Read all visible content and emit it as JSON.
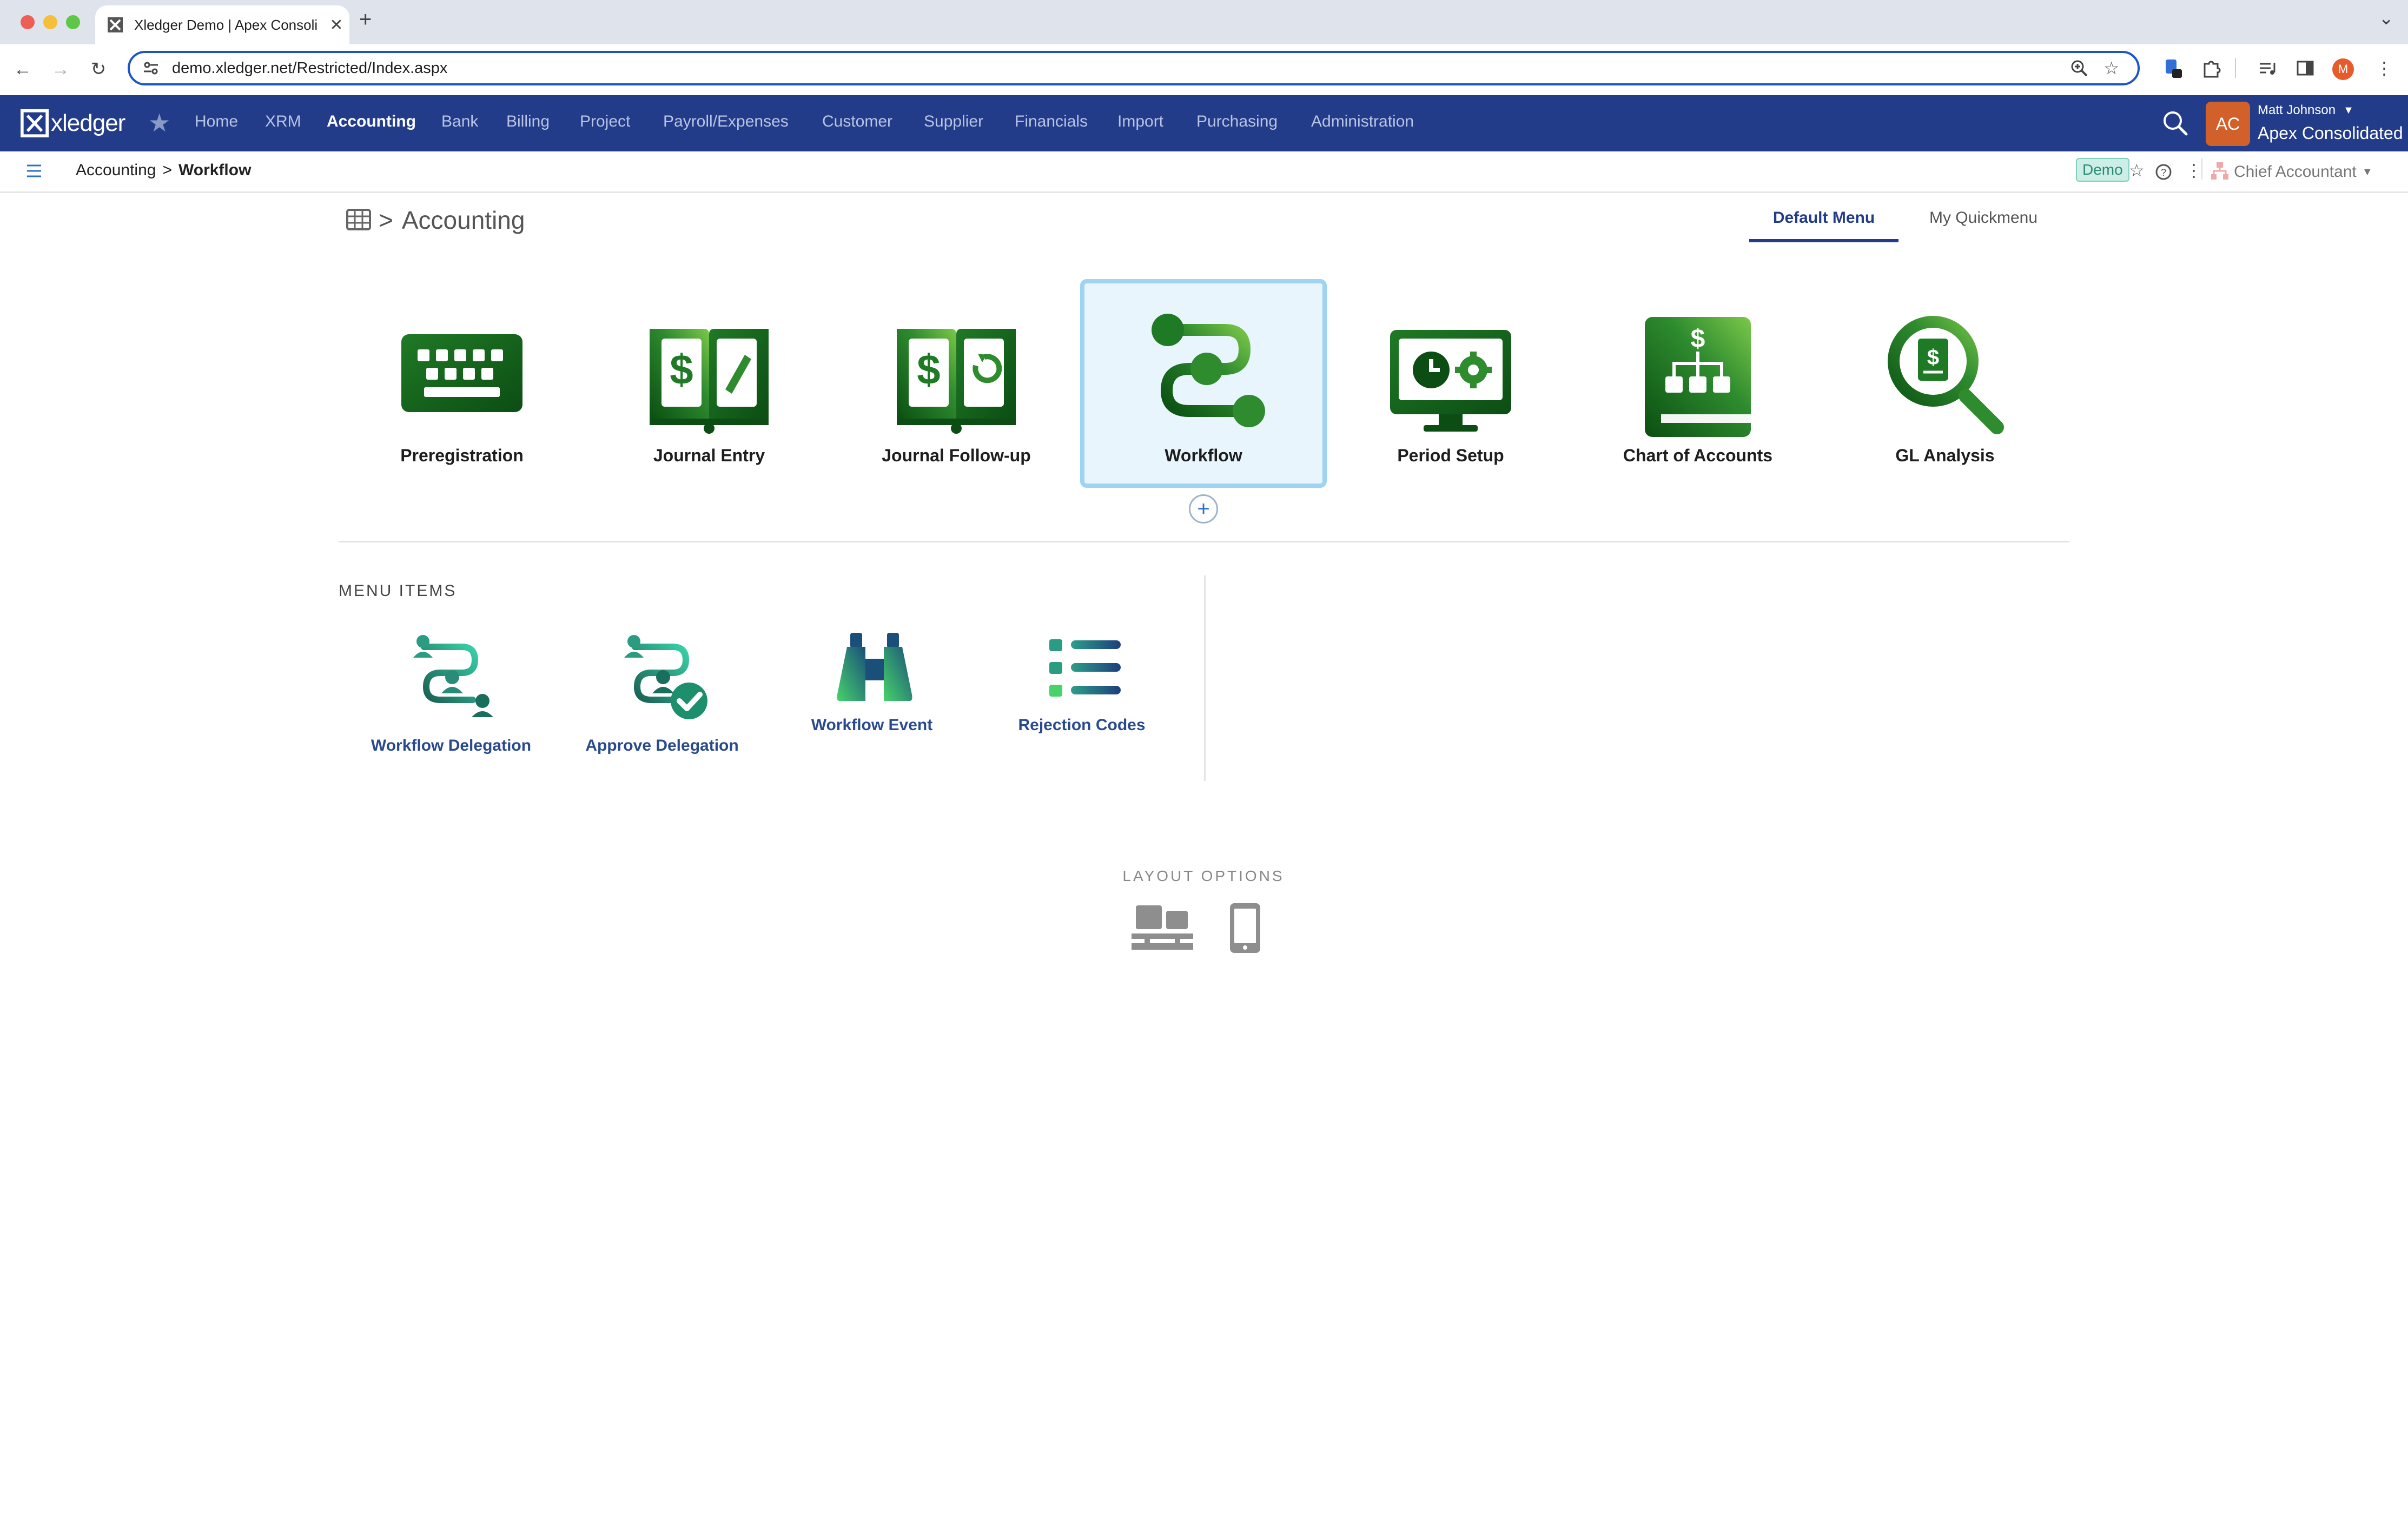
{
  "browser": {
    "tab_title": "Xledger Demo | Apex Consoli",
    "url": "demo.xledger.net/Restricted/Index.aspx",
    "profile_initial": "M",
    "new_tab_symbol": "+",
    "close_tab_symbol": "✕"
  },
  "header": {
    "logo_text": "xledger",
    "nav_items": [
      {
        "label": "Home"
      },
      {
        "label": "XRM"
      },
      {
        "label": "Accounting",
        "active": true
      },
      {
        "label": "Bank"
      },
      {
        "label": "Billing"
      },
      {
        "label": "Project"
      },
      {
        "label": "Payroll/Expenses"
      },
      {
        "label": "Customer"
      },
      {
        "label": "Supplier"
      },
      {
        "label": "Financials"
      },
      {
        "label": "Import"
      },
      {
        "label": "Purchasing"
      },
      {
        "label": "Administration"
      }
    ],
    "avatar_initials": "AC",
    "user_name": "Matt Johnson",
    "company": "Apex Consolidated"
  },
  "subheader": {
    "breadcrumb_parent": "Accounting",
    "breadcrumb_separator": ">",
    "breadcrumb_current": "Workflow",
    "demo_badge": "Demo",
    "role": "Chief Accountant"
  },
  "page": {
    "crumb_separator": ">",
    "title": "Accounting",
    "tabs": {
      "default": "Default Menu",
      "quick": "My Quickmenu"
    },
    "tiles": [
      {
        "label": "Preregistration",
        "icon": "keyboard-icon"
      },
      {
        "label": "Journal Entry",
        "icon": "journal-entry-icon"
      },
      {
        "label": "Journal Follow-up",
        "icon": "journal-followup-icon"
      },
      {
        "label": "Workflow",
        "icon": "workflow-icon",
        "selected": true
      },
      {
        "label": "Period Setup",
        "icon": "period-setup-icon"
      },
      {
        "label": "Chart of Accounts",
        "icon": "chart-of-accounts-icon"
      },
      {
        "label": "GL Analysis",
        "icon": "gl-analysis-icon"
      }
    ],
    "add_symbol": "+",
    "menu_items_title": "MENU ITEMS",
    "menu_items": [
      {
        "label": "Workflow Delegation",
        "icon": "workflow-delegation-icon"
      },
      {
        "label": "Approve Delegation",
        "icon": "approve-delegation-icon"
      },
      {
        "label": "Workflow Event",
        "icon": "binoculars-icon"
      },
      {
        "label": "Rejection Codes",
        "icon": "list-icon"
      }
    ],
    "layout_options_title": "LAYOUT OPTIONS"
  },
  "colors": {
    "header_bg": "#233c8a",
    "accent_green": "#2e8b2e",
    "selected_tile_bg": "#e8f5fd",
    "selected_tile_border": "#9fd3f2",
    "link_blue": "#2a4a8e"
  }
}
